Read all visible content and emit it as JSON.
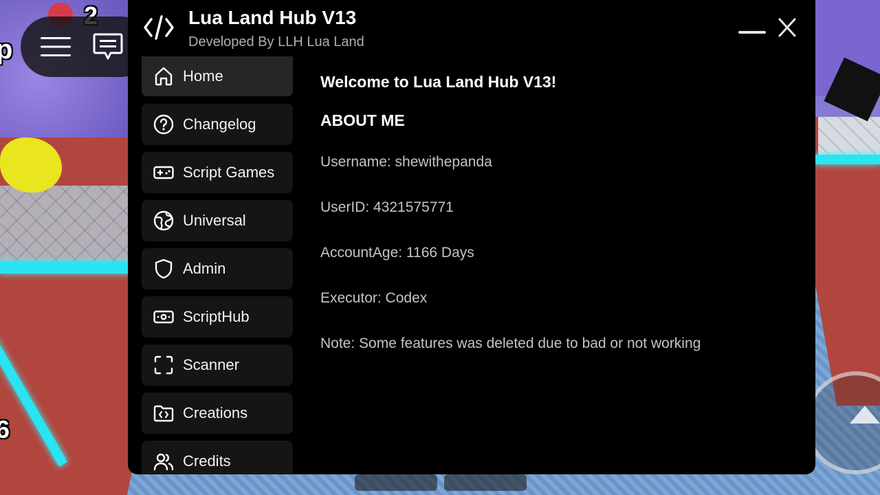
{
  "game_hud": {
    "top_number": "2",
    "left_mid_fragment": "p",
    "left_bottom_number": "6"
  },
  "roblox_bar": {
    "menu_icon": "hamburger-menu-icon",
    "chat_icon": "chat-bubble-icon"
  },
  "window": {
    "logo_icon": "code-brackets-icon",
    "title": "Lua Land Hub V13",
    "subtitle": "Developed By LLH Lua Land"
  },
  "sidebar": {
    "items": [
      {
        "label": "Home",
        "icon": "home-icon",
        "active": true
      },
      {
        "label": "Changelog",
        "icon": "question-circle-icon",
        "active": false
      },
      {
        "label": "Script Games",
        "icon": "gamepad-icon",
        "active": false
      },
      {
        "label": "Universal",
        "icon": "globe-icon",
        "active": false
      },
      {
        "label": "Admin",
        "icon": "shield-icon",
        "active": false
      },
      {
        "label": "ScriptHub",
        "icon": "cash-icon",
        "active": false
      },
      {
        "label": "Scanner",
        "icon": "scan-frame-icon",
        "active": false
      },
      {
        "label": "Creations",
        "icon": "folder-code-icon",
        "active": false
      },
      {
        "label": "Credits",
        "icon": "users-icon",
        "active": false
      }
    ]
  },
  "main": {
    "welcome": "Welcome to Lua Land Hub V13!",
    "about_heading": "ABOUT ME",
    "username": "Username: shewithepanda",
    "user_id": "UserID: 4321575771",
    "account_age": "AccountAge: 1166 Days",
    "executor": "Executor: Codex",
    "note": "Note: Some features was deleted due to bad or not working"
  },
  "colors": {
    "window_bg": "#000000",
    "nav_item_bg": "#151515",
    "nav_item_active_bg": "#262626",
    "text_primary": "#ffffff",
    "text_secondary": "#c4c4c4"
  }
}
